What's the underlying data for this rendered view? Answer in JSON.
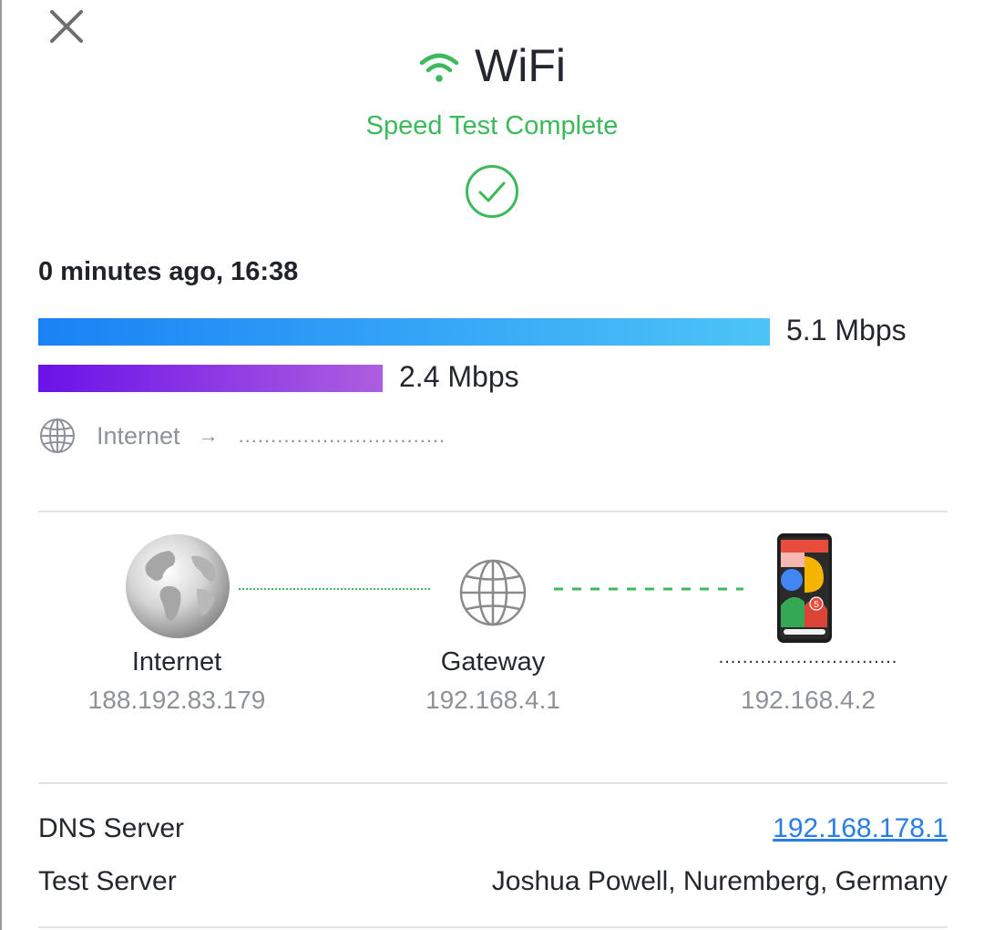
{
  "header": {
    "title": "WiFi",
    "status": "Speed Test Complete",
    "close_icon": "close-icon",
    "wifi_icon": "wifi-icon",
    "check_icon": "check-circle-icon"
  },
  "result": {
    "timestamp": "0 minutes ago, 16:38",
    "download": {
      "value": 5.1,
      "label": "5.1 Mbps",
      "color_start": "#1a82f5",
      "color_end": "#4dc4f7"
    },
    "upload": {
      "value": 2.4,
      "label": "2.4 Mbps",
      "color_start": "#6a12e8",
      "color_end": "#ad5ee0"
    },
    "route": {
      "icon": "globe-icon",
      "from": "Internet",
      "arrow": "→",
      "to": "................................"
    }
  },
  "topology": {
    "nodes": [
      {
        "label": "Internet",
        "ip": "188.192.83.179",
        "icon": "earth-icon"
      },
      {
        "label": "Gateway",
        "ip": "192.168.4.1",
        "icon": "globe-icon"
      },
      {
        "label": "..............................",
        "ip": "192.168.4.2",
        "icon": "phone-icon"
      }
    ]
  },
  "info": {
    "dns_label": "DNS Server",
    "dns_value": "192.168.178.1",
    "test_server_label": "Test Server",
    "test_server_value": "Joshua Powell, Nuremberg, Germany"
  },
  "colors": {
    "accent_green": "#3cb95b",
    "link_blue": "#2b7de6",
    "muted_text": "#8e9298"
  }
}
